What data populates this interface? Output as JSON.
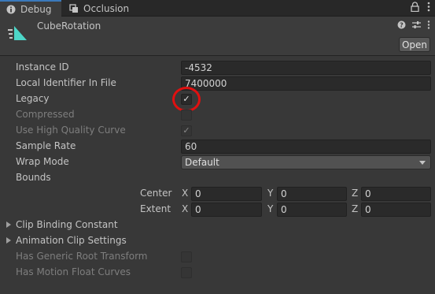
{
  "tabs": [
    {
      "label": "Debug",
      "icon": "info-icon"
    },
    {
      "label": "Occlusion",
      "icon": "occlusion-icon"
    }
  ],
  "header": {
    "asset_name": "CubeRotation",
    "asset_icon": "animation-clip-icon",
    "open_label": "Open"
  },
  "fields": {
    "instance_id": {
      "label": "Instance ID",
      "value": "-4532"
    },
    "local_identifier": {
      "label": "Local Identifier In File",
      "value": "7400000"
    },
    "legacy": {
      "label": "Legacy",
      "checked": "✓"
    },
    "compressed": {
      "label": "Compressed"
    },
    "use_high_quality_curve": {
      "label": "Use High Quality Curve",
      "checked": "✓"
    },
    "sample_rate": {
      "label": "Sample Rate",
      "value": "60"
    },
    "wrap_mode": {
      "label": "Wrap Mode",
      "value": "Default"
    },
    "bounds": {
      "label": "Bounds",
      "center": {
        "label": "Center",
        "x": "0",
        "y": "0",
        "z": "0"
      },
      "extent": {
        "label": "Extent",
        "x": "0",
        "y": "0",
        "z": "0"
      },
      "axis_x": "X",
      "axis_y": "Y",
      "axis_z": "Z"
    },
    "clip_binding_constant": {
      "label": "Clip Binding Constant"
    },
    "animation_clip_settings": {
      "label": "Animation Clip Settings"
    },
    "has_generic_root_transform": {
      "label": "Has Generic Root Transform"
    },
    "has_motion_float_curves": {
      "label": "Has Motion Float Curves"
    }
  },
  "colors": {
    "accent": "#3a79bb",
    "highlight": "#e01010",
    "asset_icon": "#4dd6c8"
  }
}
